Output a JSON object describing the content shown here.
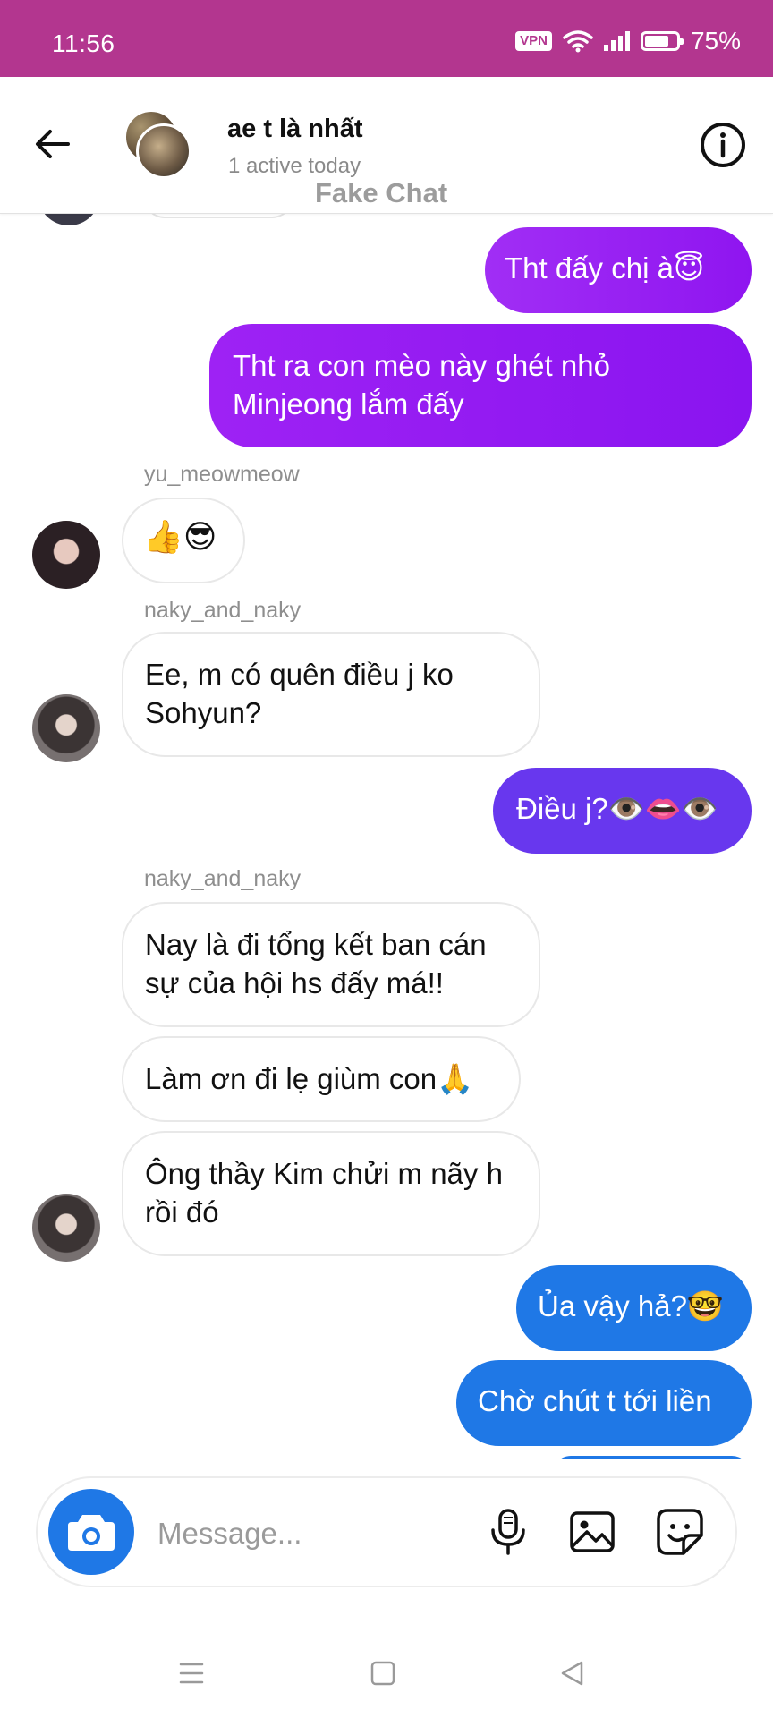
{
  "status_bar": {
    "time": "11:56",
    "vpn": "VPN",
    "battery": "75%",
    "battery_level": 0.75
  },
  "header": {
    "title": "ae t là nhất",
    "subtitle": "1 active today",
    "watermark": "Fake Chat",
    "back_icon": "arrow-left-icon",
    "info_icon": "info-icon"
  },
  "messages": [
    {
      "direction": "out",
      "text": "Tht đấy chị à😇",
      "color": "#9b1ff4"
    },
    {
      "direction": "out",
      "text": "Tht ra con mèo này ghét nhỏ Minjeong lắm đấy",
      "color": "#9b1ff4"
    },
    {
      "direction": "in",
      "sender": "yu_meowmeow",
      "text": "👍😎"
    },
    {
      "direction": "in",
      "sender": "naky_and_naky",
      "text": "Ee, m có quên điều j ko Sohyun?"
    },
    {
      "direction": "out",
      "text": "Điều j?👁️👄👁️",
      "color": "#6837ee"
    },
    {
      "direction": "in",
      "sender": "naky_and_naky",
      "text": "Nay là đi tổng kết ban cán sự của hội hs đấy má!!"
    },
    {
      "direction": "in",
      "text": "Làm ơn đi lẹ giùm con🙏"
    },
    {
      "direction": "in",
      "text": "Ông thầy Kim chửi m nãy h rồi đó"
    },
    {
      "direction": "out",
      "text": "Ủa vậy hả?🤓",
      "color": "#1f78e6"
    },
    {
      "direction": "out",
      "text": "Chờ chút t tới liền",
      "color": "#1f78e6"
    }
  ],
  "composer": {
    "placeholder": "Message...",
    "icons": [
      "camera-icon",
      "microphone-icon",
      "image-icon",
      "sticker-icon"
    ]
  },
  "nav": {
    "icons": [
      "menu-icon",
      "home-icon",
      "back-icon"
    ]
  },
  "colors": {
    "status_bar": "#b3368f",
    "bubble_purple": "#9b1ff4",
    "bubble_indigo": "#6837ee",
    "bubble_blue": "#1f78e6"
  }
}
